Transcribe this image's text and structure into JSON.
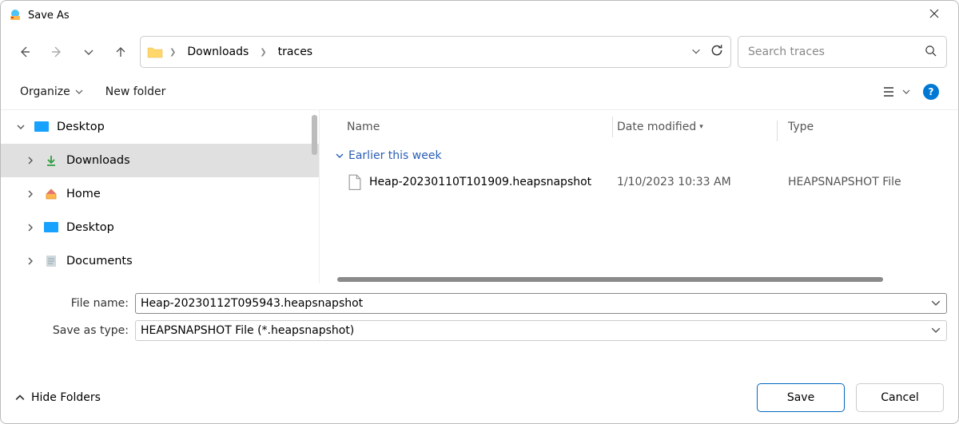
{
  "window": {
    "title": "Save As"
  },
  "breadcrumb": {
    "items": [
      "Downloads",
      "traces"
    ]
  },
  "search": {
    "placeholder": "Search traces"
  },
  "toolbar": {
    "organize": "Organize",
    "new_folder": "New folder"
  },
  "sidebar": {
    "items": [
      {
        "label": "Desktop"
      },
      {
        "label": "Downloads"
      },
      {
        "label": "Home"
      },
      {
        "label": "Desktop"
      },
      {
        "label": "Documents"
      }
    ]
  },
  "columns": {
    "name": "Name",
    "date": "Date modified",
    "type": "Type"
  },
  "group": {
    "label": "Earlier this week"
  },
  "files": [
    {
      "name": "Heap-20230110T101909.heapsnapshot",
      "date": "1/10/2023 10:33 AM",
      "type": "HEAPSNAPSHOT File"
    }
  ],
  "form": {
    "filename_label": "File name:",
    "filename_value": "Heap-20230112T095943.heapsnapshot",
    "saveastype_label": "Save as type:",
    "saveastype_value": "HEAPSNAPSHOT File (*.heapsnapshot)"
  },
  "footer": {
    "hide_folders": "Hide Folders",
    "save": "Save",
    "cancel": "Cancel"
  }
}
